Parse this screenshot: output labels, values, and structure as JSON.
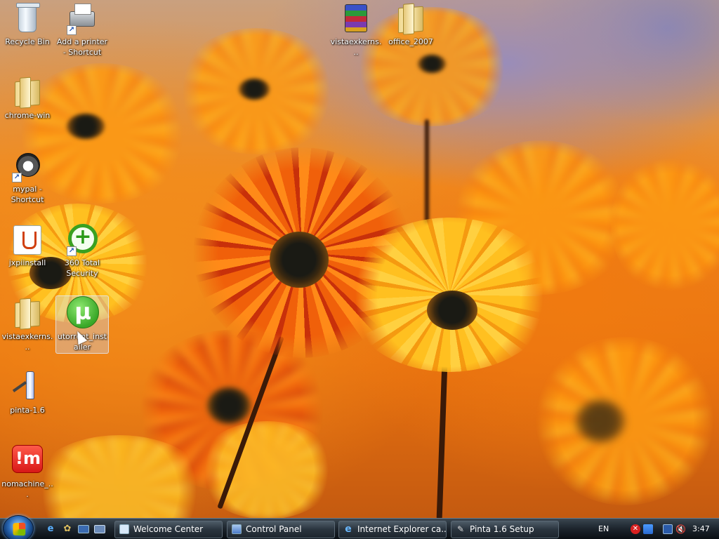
{
  "desktop": {
    "icons": [
      {
        "label": "Recycle Bin"
      },
      {
        "label": "Add a printer - Shortcut"
      },
      {
        "label": "vistaexkerns..."
      },
      {
        "label": "office_2007"
      },
      {
        "label": "chrome-win"
      },
      {
        "label": "mypal - Shortcut"
      },
      {
        "label": "jxpiinstall"
      },
      {
        "label": "360 Total Security"
      },
      {
        "label": "vistaexkerns..."
      },
      {
        "label": "utorrent_installer"
      },
      {
        "label": "pinta-1.6"
      },
      {
        "label": "nomachine_..."
      }
    ]
  },
  "taskbar": {
    "tasks": [
      {
        "label": "Welcome Center"
      },
      {
        "label": "Control Panel"
      },
      {
        "label": "Internet Explorer ca..."
      },
      {
        "label": "Pinta 1.6 Setup"
      }
    ],
    "language": "EN",
    "clock": "3:47"
  },
  "colors": {
    "taskbar": "#1c242c",
    "wallpaper_accent": "#f08a20"
  }
}
